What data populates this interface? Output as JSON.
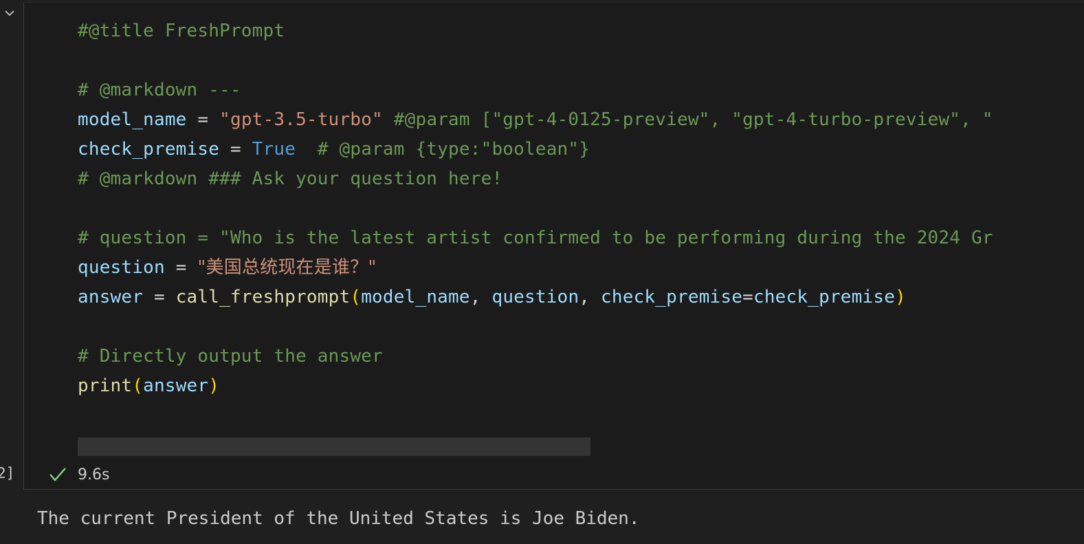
{
  "gutter": {
    "execution_count": "2]"
  },
  "cell": {
    "code_lines": [
      [
        {
          "t": "#@title FreshPrompt",
          "c": "c"
        }
      ],
      [],
      [
        {
          "t": "# @markdown ---",
          "c": "c"
        }
      ],
      [
        {
          "t": "model_name",
          "c": "v"
        },
        {
          "t": " = ",
          "c": "o"
        },
        {
          "t": "\"gpt-3.5-turbo\"",
          "c": "s"
        },
        {
          "t": " #@param [\"gpt-4-0125-preview\", \"gpt-4-turbo-preview\", \"",
          "c": "c"
        }
      ],
      [
        {
          "t": "check_premise",
          "c": "v"
        },
        {
          "t": " = ",
          "c": "o"
        },
        {
          "t": "True",
          "c": "k"
        },
        {
          "t": "  # @param {type:\"boolean\"}",
          "c": "c"
        }
      ],
      [
        {
          "t": "# @markdown ### Ask your question here!",
          "c": "c"
        }
      ],
      [],
      [
        {
          "t": "# question = \"Who is the latest artist confirmed to be performing during the 2024 Gr",
          "c": "c"
        }
      ],
      [
        {
          "t": "question",
          "c": "v"
        },
        {
          "t": " = ",
          "c": "o"
        },
        {
          "t": "\"美国总统现在是谁？\"",
          "c": "s cn"
        }
      ],
      [
        {
          "t": "answer",
          "c": "v"
        },
        {
          "t": " = ",
          "c": "o"
        },
        {
          "t": "call_freshprompt",
          "c": "f"
        },
        {
          "t": "(",
          "c": "p"
        },
        {
          "t": "model_name",
          "c": "v"
        },
        {
          "t": ", ",
          "c": "o"
        },
        {
          "t": "question",
          "c": "v"
        },
        {
          "t": ", ",
          "c": "o"
        },
        {
          "t": "check_premise",
          "c": "v"
        },
        {
          "t": "=",
          "c": "o"
        },
        {
          "t": "check_premise",
          "c": "v"
        },
        {
          "t": ")",
          "c": "p"
        }
      ],
      [],
      [
        {
          "t": "# Directly output the answer",
          "c": "c"
        }
      ],
      [
        {
          "t": "print",
          "c": "f"
        },
        {
          "t": "(",
          "c": "p"
        },
        {
          "t": "answer",
          "c": "v"
        },
        {
          "t": ")",
          "c": "p"
        }
      ]
    ],
    "status": {
      "icon": "check-icon",
      "duration": "9.6s",
      "color": "#89d185"
    }
  },
  "output": {
    "text": "The current President of the United States is Joe Biden."
  },
  "colors": {
    "background": "#1f1f1f",
    "comment": "#6a9955",
    "string": "#ce9178",
    "variable": "#9cdcfe",
    "function": "#dcdcaa",
    "keyword": "#569cd6",
    "bracket": "#ffd700"
  }
}
